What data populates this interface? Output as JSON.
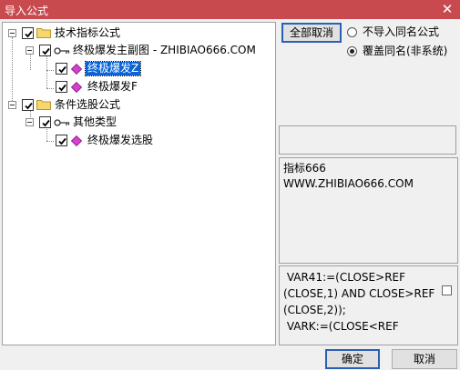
{
  "window": {
    "title": "导入公式",
    "close_glyph": "✕"
  },
  "tree": {
    "group1": {
      "label": "技术指标公式",
      "checked": true
    },
    "group1_sub": {
      "label": "终极爆发主副图 - ZHIBIAO666.COM",
      "checked": true
    },
    "group1_items": [
      {
        "label": "终极爆发Z",
        "checked": true,
        "selected": true
      },
      {
        "label": "终极爆发F",
        "checked": true,
        "selected": false
      }
    ],
    "group2": {
      "label": "条件选股公式",
      "checked": true
    },
    "group2_sub": {
      "label": "其他类型",
      "checked": true
    },
    "group2_items": [
      {
        "label": "终极爆发选股",
        "checked": true,
        "selected": false
      }
    ]
  },
  "options": {
    "cancel_all_label": "全部取消",
    "radio_skip_label": "不导入同名公式",
    "radio_overwrite_label": "覆盖同名(非系统)",
    "selected": "overwrite"
  },
  "description": {
    "line1": "指标666",
    "line2": "WWW.ZHIBIAO666.COM"
  },
  "code": {
    "line1": " VAR41:=(CLOSE>REF",
    "line2": "(CLOSE,1) AND CLOSE>REF",
    "line3": "(CLOSE,2));",
    "line4": " VARK:=(CLOSE<REF"
  },
  "footer": {
    "ok_label": "确定",
    "cancel_label": "取消"
  },
  "colors": {
    "titlebar": "#c84a4f",
    "selection": "#0a64d8",
    "folder": "#f5d76e",
    "gem": "#d63fd0"
  }
}
